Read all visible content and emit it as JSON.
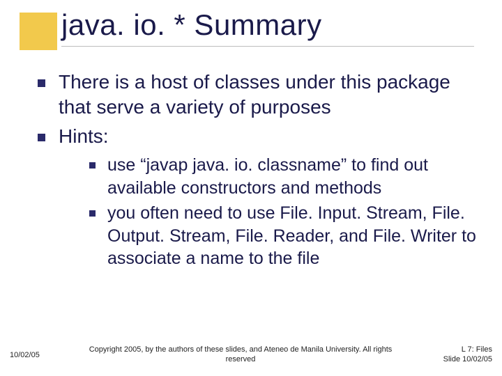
{
  "title": "java. io. * Summary",
  "bullets": [
    {
      "text": "There is a host of classes under this package that serve a variety of purposes"
    },
    {
      "text": "Hints:",
      "children": [
        {
          "text": "use “javap java. io. classname” to find out available constructors and methods"
        },
        {
          "text": "you often need to use File. Input. Stream, File. Output. Stream, File. Reader, and File. Writer to associate a name to the file"
        }
      ]
    }
  ],
  "footer": {
    "left": "10/02/05",
    "center": "Copyright 2005, by the authors of these slides, and Ateneo de Manila University. All rights reserved",
    "right_line1": "L 7: Files",
    "right_line2": "Slide 10/02/05"
  }
}
